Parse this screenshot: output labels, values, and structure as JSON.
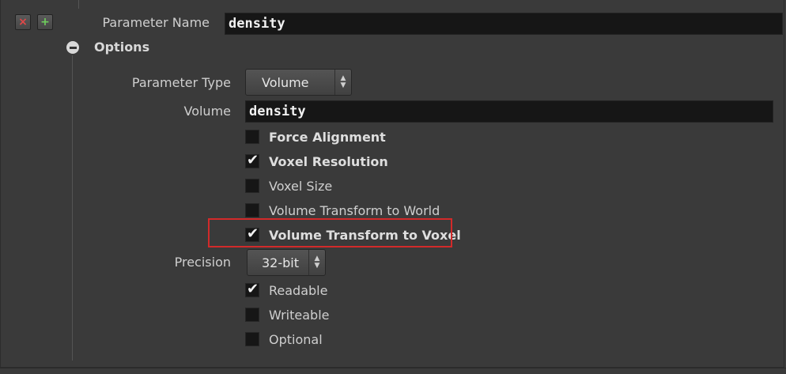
{
  "toolbar": {
    "remove_icon": "×",
    "add_icon": "+"
  },
  "param_name": {
    "label": "Parameter Name",
    "value": "density"
  },
  "options": {
    "title": "Options"
  },
  "param_type": {
    "label": "Parameter Type",
    "selected": "Volume"
  },
  "volume": {
    "label": "Volume",
    "value": "density"
  },
  "checkboxes": [
    {
      "label": "Force Alignment",
      "checked": false
    },
    {
      "label": "Voxel Resolution",
      "checked": true
    },
    {
      "label": "Voxel Size",
      "checked": false
    },
    {
      "label": "Volume Transform to World",
      "checked": false
    },
    {
      "label": "Volume Transform to Voxel",
      "checked": true
    }
  ],
  "precision": {
    "label": "Precision",
    "selected": "32-bit"
  },
  "access": [
    {
      "label": "Readable",
      "checked": true
    },
    {
      "label": "Writeable",
      "checked": false
    },
    {
      "label": "Optional",
      "checked": false
    }
  ],
  "check_glyph": "✔",
  "colors": {
    "background": "#3a3a3a",
    "field_bg": "#161616",
    "remove_icon": "#e04848",
    "add_icon": "#6fcf5c",
    "highlight": "#d22a2a"
  }
}
